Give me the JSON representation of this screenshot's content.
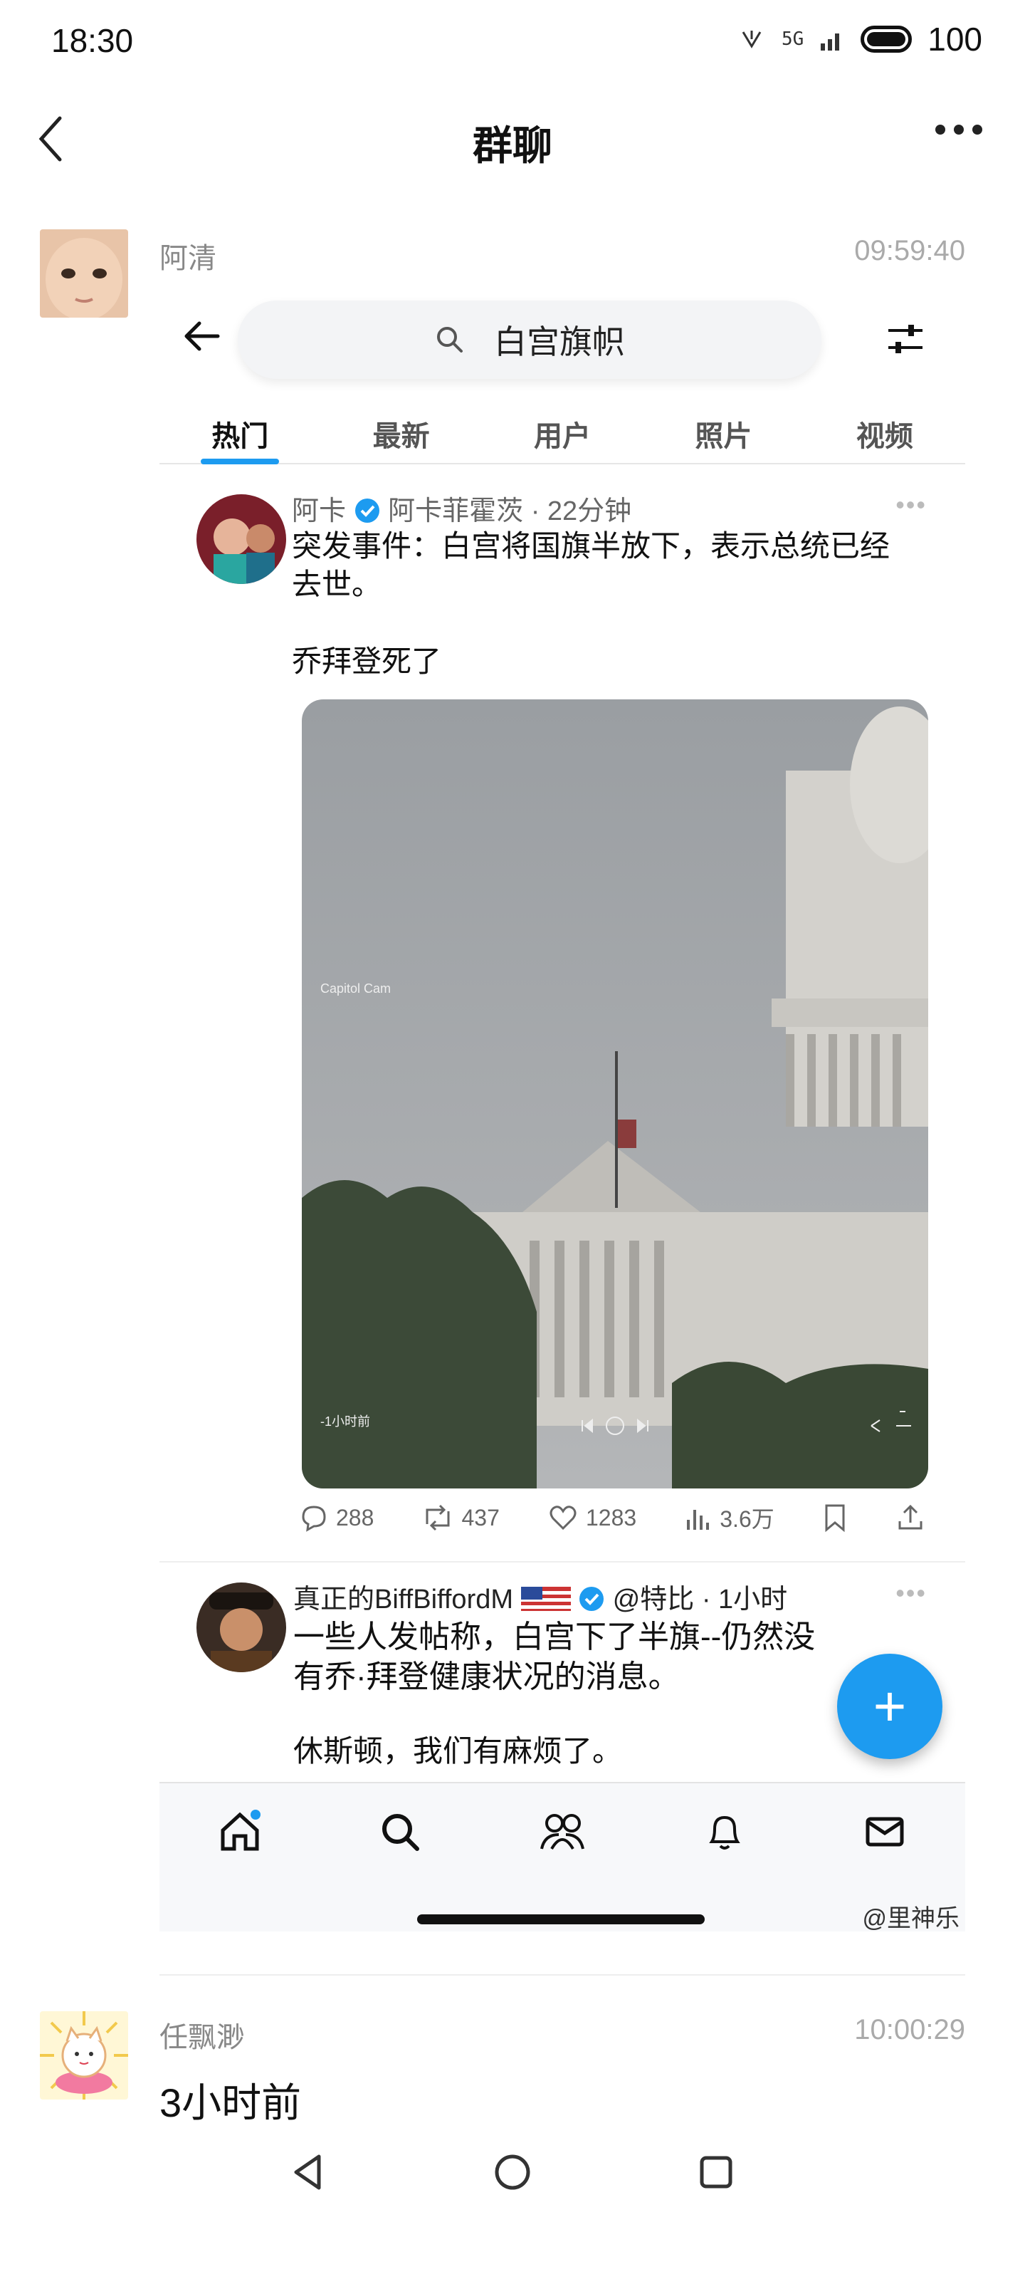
{
  "status_bar": {
    "time": "18:30",
    "signal_label": "5G",
    "battery": "100"
  },
  "header": {
    "title": "群聊"
  },
  "messages": [
    {
      "sender": "阿清",
      "time": "09:59:40"
    },
    {
      "sender": "任飘渺",
      "time": "10:00:29",
      "text": "3小时前"
    }
  ],
  "shared_screenshot": {
    "search": {
      "query": "白宫旗帜"
    },
    "tabs": [
      "热门",
      "最新",
      "用户",
      "照片",
      "视频"
    ],
    "active_tab": "热门",
    "posts": [
      {
        "display_name": "阿卡",
        "handle_line": "阿卡菲霍茨 · 22分钟",
        "text_line1": "突发事件：白宫将国旗半放下，表示总统已经",
        "text_line2": "去世。",
        "text_line3": "乔拜登死了",
        "media": {
          "label": "Capitol Cam",
          "time_ago": "-1小时前"
        },
        "stats": {
          "replies": "288",
          "retweets": "437",
          "likes": "1283",
          "views": "3.6万"
        }
      },
      {
        "display_name": "真正的BiffBiffordM",
        "handle_line": "@特比 · 1小时",
        "text_line1": "一些人发帖称，白宫下了半旗--仍然没",
        "text_line2": "有乔·拜登健康状况的消息。",
        "text_line3": "休斯顿，我们有麻烦了。"
      }
    ],
    "watermark": "@里神乐",
    "icons": [
      "home-icon",
      "search-icon",
      "people-icon",
      "bell-icon",
      "mail-icon"
    ]
  },
  "colors": {
    "accent": "#1d9bf0"
  }
}
